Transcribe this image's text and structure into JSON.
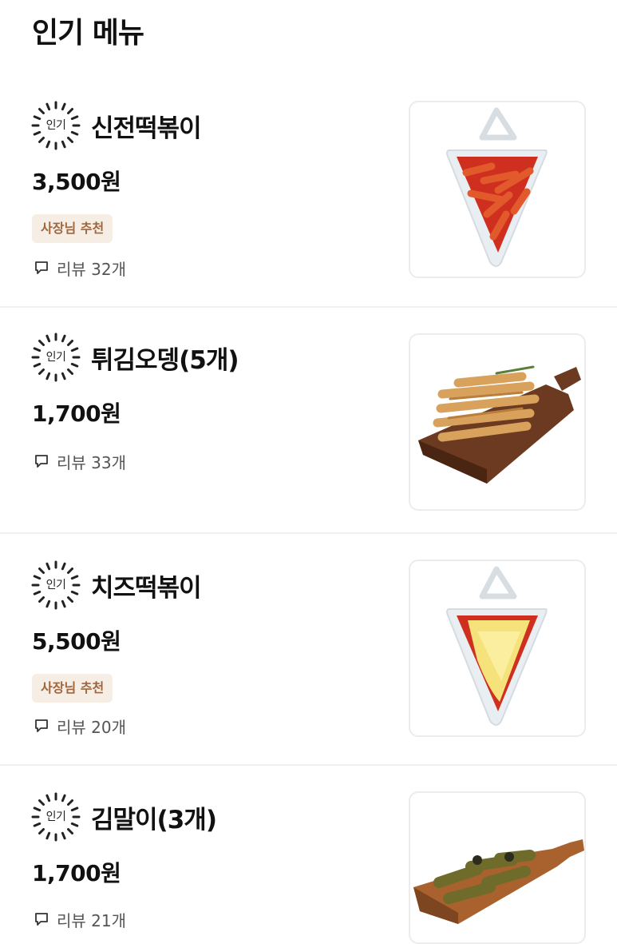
{
  "section": {
    "title": "인기 메뉴"
  },
  "popular_badge_label": "인기",
  "review_icon": "speech-bubble-icon",
  "colors": {
    "owner_badge_bg": "#f6eee5",
    "owner_badge_text": "#a0663d",
    "divider": "#f0f0f0"
  },
  "items": [
    {
      "name": "신전떡볶이",
      "price": "3,500원",
      "badge": "사장님 추천",
      "review": "리뷰 32개",
      "image": "tteokbokki-cup"
    },
    {
      "name": "튀김오뎅(5개)",
      "price": "1,700원",
      "badge": "",
      "review": "리뷰 33개",
      "image": "fried-fishcake-board"
    },
    {
      "name": "치즈떡볶이",
      "price": "5,500원",
      "badge": "사장님 추천",
      "review": "리뷰 20개",
      "image": "cheese-tteokbokki-cup"
    },
    {
      "name": "김말이(3개)",
      "price": "1,700원",
      "badge": "",
      "review": "리뷰 21개",
      "image": "gimmari-board"
    }
  ]
}
